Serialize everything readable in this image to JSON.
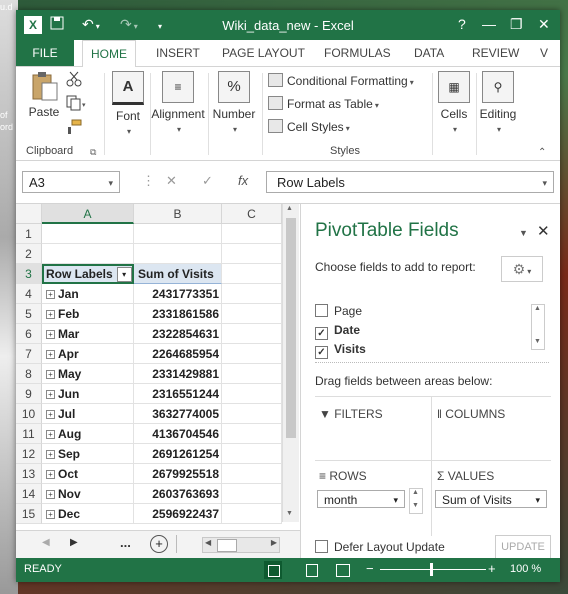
{
  "desktop": {
    "text1": "u.d",
    "text2": "of",
    "text3": "ord"
  },
  "titlebar": {
    "title": "Wiki_data_new - Excel",
    "app_badge": "X",
    "help": "?",
    "minimize": "—",
    "restore": "❐",
    "close": "✕"
  },
  "tabs": {
    "file": "FILE",
    "home": "HOME",
    "insert": "INSERT",
    "page_layout": "PAGE LAYOUT",
    "formulas": "FORMULAS",
    "data": "DATA",
    "review": "REVIEW",
    "more": "V"
  },
  "ribbon": {
    "paste": "Paste",
    "clipboard": "Clipboard",
    "font": "Font",
    "alignment": "Alignment",
    "number": "Number",
    "number_icon": "%",
    "font_icon": "A",
    "conditional_formatting": "Conditional Formatting",
    "format_as_table": "Format as Table",
    "cell_styles": "Cell Styles",
    "styles": "Styles",
    "cells": "Cells",
    "editing": "Editing"
  },
  "formula_bar": {
    "name_box": "A3",
    "fx": "fx",
    "value": "Row Labels"
  },
  "grid": {
    "columns": [
      "A",
      "B",
      "C"
    ],
    "rows": [
      "1",
      "2",
      "3",
      "4",
      "5",
      "6",
      "7",
      "8",
      "9",
      "10",
      "11",
      "12",
      "13",
      "14",
      "15"
    ],
    "header_row_label": "Row Labels",
    "header_value_label": "Sum of Visits",
    "data": [
      {
        "month": "Jan",
        "visits": "2431773351"
      },
      {
        "month": "Feb",
        "visits": "2331861586"
      },
      {
        "month": "Mar",
        "visits": "2322854631"
      },
      {
        "month": "Apr",
        "visits": "2264685954"
      },
      {
        "month": "May",
        "visits": "2331429881"
      },
      {
        "month": "Jun",
        "visits": "2316551244"
      },
      {
        "month": "Jul",
        "visits": "3632774005"
      },
      {
        "month": "Aug",
        "visits": "4136704546"
      },
      {
        "month": "Sep",
        "visits": "2691261254"
      },
      {
        "month": "Oct",
        "visits": "2679925518"
      },
      {
        "month": "Nov",
        "visits": "2603763693"
      },
      {
        "month": "Dec",
        "visits": "2596922437"
      }
    ]
  },
  "sheetbar": {
    "ellipsis": "..."
  },
  "pivot_pane": {
    "title": "PivotTable Fields",
    "subtitle": "Choose fields to add to report:",
    "fields": [
      {
        "name": "Page",
        "checked": false
      },
      {
        "name": "Date",
        "checked": true
      },
      {
        "name": "Visits",
        "checked": true
      }
    ],
    "drag_hint": "Drag fields between areas below:",
    "filters": "FILTERS",
    "columns": "COLUMNS",
    "rows": "ROWS",
    "values": "VALUES",
    "rows_field": "month",
    "values_field": "Sum of Visits",
    "defer_layout": "Defer Layout Update",
    "update": "UPDATE"
  },
  "status_bar": {
    "ready": "READY",
    "zoom": "100 %"
  }
}
